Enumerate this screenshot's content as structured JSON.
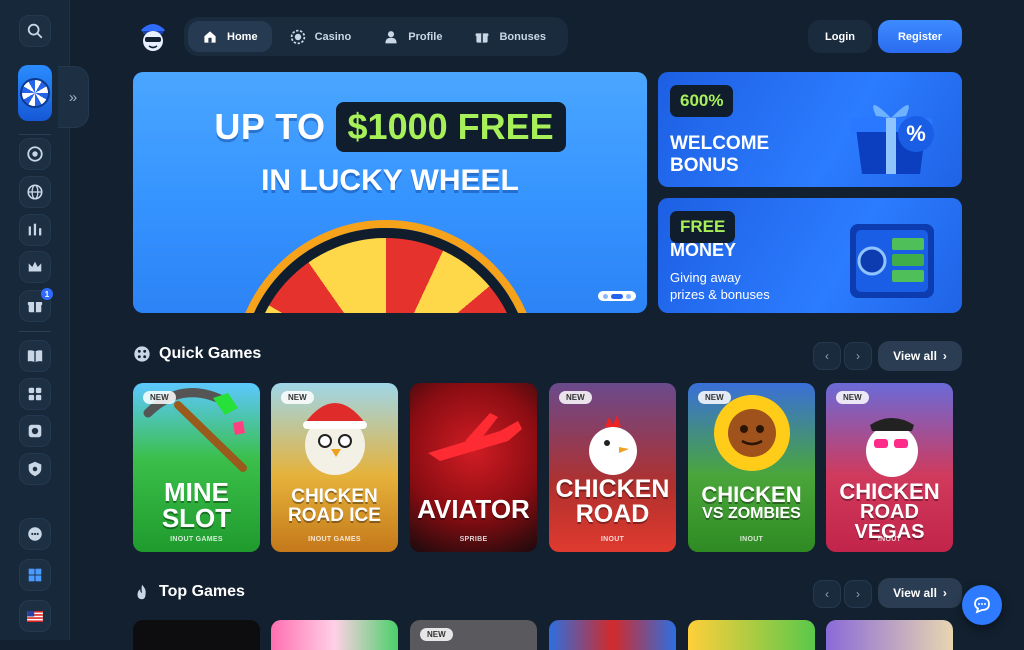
{
  "nav": {
    "items": [
      {
        "label": "Home",
        "icon": "home-icon",
        "active": true
      },
      {
        "label": "Casino",
        "icon": "chip-icon",
        "active": false
      },
      {
        "label": "Profile",
        "icon": "user-icon",
        "active": false
      },
      {
        "label": "Bonuses",
        "icon": "gift-icon",
        "active": false
      }
    ],
    "login": "Login",
    "register": "Register"
  },
  "sidebar": {
    "icons": [
      "search-icon",
      "lucky-wheel-icon",
      "chip-icon",
      "globe-icon",
      "sports-icon",
      "crown-icon",
      "gift-icon",
      "book-icon",
      "games-icon",
      "vault-icon",
      "shield-icon",
      "telegram-icon",
      "support-icon",
      "windows-icon",
      "flag-us-icon"
    ],
    "gift_badge": "1"
  },
  "hero": {
    "line1_a": "UP TO",
    "line1_b": "$1000 FREE",
    "line2": "IN LUCKY WHEEL",
    "prev": "‹",
    "next": "›"
  },
  "promos": [
    {
      "tag": "600%",
      "heading_1": "WELCOME",
      "heading_2": "BONUS"
    },
    {
      "tag": "FREE",
      "heading_1": "MONEY",
      "sub_1": "Giving away",
      "sub_2": "prizes & bonuses"
    }
  ],
  "quick_games": {
    "title": "Quick Games",
    "view_all": "View all",
    "games": [
      {
        "name_1": "MINE",
        "name_2": "SLOT",
        "provider": "INOUT GAMES",
        "new": "NEW",
        "bg": "#2fb43a"
      },
      {
        "name_1": "CHICKEN",
        "name_2": "ROAD ICE",
        "provider": "INOUT GAMES",
        "new": "NEW",
        "bg": "#d08a1e"
      },
      {
        "name_1": "AVIATOR",
        "name_2": "",
        "provider": "SPRIBE",
        "new": "",
        "bg": "#b3121b"
      },
      {
        "name_1": "CHICKEN",
        "name_2": "ROAD",
        "provider": "INOUT",
        "new": "NEW",
        "bg": "#c8302c"
      },
      {
        "name_1": "CHICKEN",
        "name_2": "VS ZOMBIES",
        "provider": "INOUT",
        "new": "NEW",
        "bg": "#4a9a2a"
      },
      {
        "name_1": "CHICKEN",
        "name_2": "ROAD VEGAS",
        "provider": "INOUT",
        "new": "NEW",
        "bg": "#c62a4e"
      }
    ]
  },
  "top_games": {
    "title": "Top Games",
    "view_all": "View all",
    "new_label": "NEW"
  }
}
